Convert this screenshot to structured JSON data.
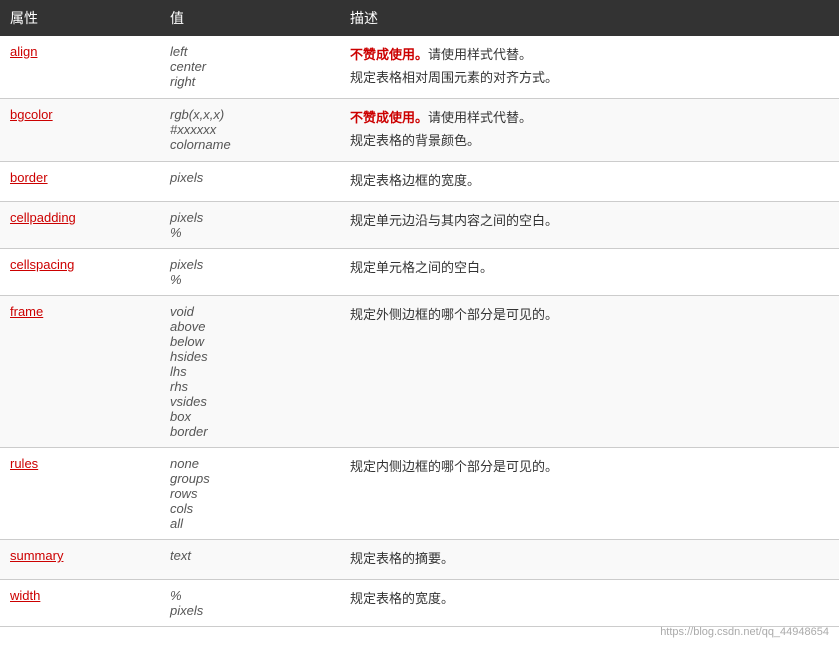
{
  "header": {
    "col_attr": "属性",
    "col_val": "值",
    "col_desc": "描述"
  },
  "rows": [
    {
      "attr": "align",
      "values": [
        "left",
        "center",
        "right"
      ],
      "desc_lines": [
        {
          "text": "不赞成使用。",
          "class": "deprecated",
          "suffix": "请使用样式代替。"
        },
        {
          "text": "规定表格相对周围元素的对齐方式。",
          "class": "desc-text"
        }
      ]
    },
    {
      "attr": "bgcolor",
      "values": [
        "rgb(x,x,x)",
        "#xxxxxx",
        "colorname"
      ],
      "desc_lines": [
        {
          "text": "不赞成使用。",
          "class": "deprecated",
          "suffix": "请使用样式代替。"
        },
        {
          "text": "规定表格的背景颜色。",
          "class": "desc-text"
        }
      ]
    },
    {
      "attr": "border",
      "values": [
        "pixels"
      ],
      "desc_lines": [
        {
          "text": "规定表格边框的宽度。",
          "class": "desc-text"
        }
      ]
    },
    {
      "attr": "cellpadding",
      "values": [
        "pixels",
        "%"
      ],
      "desc_lines": [
        {
          "text": "规定单元边沿与其内容之间的空白。",
          "class": "desc-text"
        }
      ]
    },
    {
      "attr": "cellspacing",
      "values": [
        "pixels",
        "%"
      ],
      "desc_lines": [
        {
          "text": "规定单元格之间的空白。",
          "class": "desc-text"
        }
      ]
    },
    {
      "attr": "frame",
      "values": [
        "void",
        "above",
        "below",
        "hsides",
        "lhs",
        "rhs",
        "vsides",
        "box",
        "border"
      ],
      "desc_lines": [
        {
          "text": "规定外侧边框的哪个部分是可见的。",
          "class": "desc-text"
        }
      ]
    },
    {
      "attr": "rules",
      "values": [
        "none",
        "groups",
        "rows",
        "cols",
        "all"
      ],
      "desc_lines": [
        {
          "text": "规定内侧边框的哪个部分是可见的。",
          "class": "desc-text"
        }
      ]
    },
    {
      "attr": "summary",
      "values": [
        "text"
      ],
      "desc_lines": [
        {
          "text": "规定表格的摘要。",
          "class": "desc-text"
        }
      ]
    },
    {
      "attr": "width",
      "values": [
        "%",
        "pixels"
      ],
      "desc_lines": [
        {
          "text": "规定表格的宽度。",
          "class": "desc-text"
        }
      ]
    }
  ],
  "watermark": "https://blog.csdn.net/qq_44948654"
}
